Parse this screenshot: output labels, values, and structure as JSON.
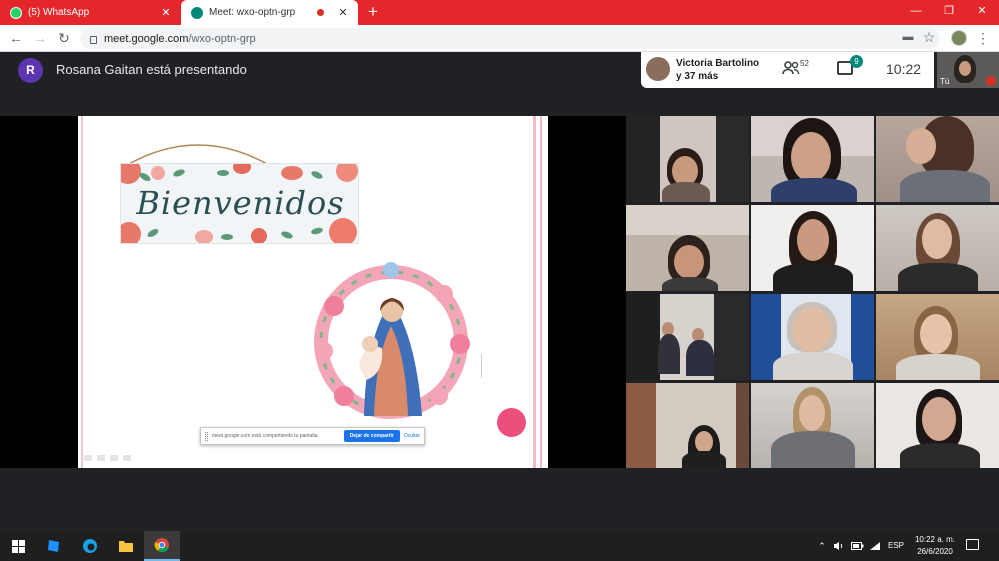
{
  "browser": {
    "tabs": [
      {
        "label": "(5) WhatsApp",
        "close": "✕"
      },
      {
        "label": "Meet: wxo-optn-grp",
        "close": "✕"
      }
    ],
    "new_tab": "+",
    "window_controls": [
      "—",
      "❐",
      "✕"
    ],
    "nav": {
      "back": "←",
      "forward": "→",
      "reload": "↻"
    },
    "url_host": "meet.google.com",
    "url_path": "/wxo-optn-grp",
    "toolbar_icons": {
      "camera": "▬",
      "star": "☆",
      "menu": "⋮"
    }
  },
  "meet": {
    "presenter_initial": "R",
    "presenter_text": "Rosana Gaitan está presentando",
    "featured_name_line1": "Victoria Bartolino",
    "featured_name_line2": "y 37 más",
    "people_count": "52",
    "chat_badge": "9",
    "clock": "10:22",
    "self_label": "Tú"
  },
  "slide": {
    "banner_text": "Bienvenidos",
    "share_text": "meet.google.com está compartiendo tu pantalla.",
    "stop_share_label": "Dejar de compartir",
    "hide_label": "Ocultar"
  },
  "taskbar": {
    "tray_chevron": "⌃",
    "language": "ESP",
    "time": "10:22 a. m.",
    "date": "26/6/2020"
  },
  "colors": {
    "chrome_tabstrip": "#e3272b",
    "meet_bg": "#202124",
    "presenter_avatar": "#5e35b1",
    "chat_badge": "#00897b",
    "stop_share_button": "#1a73e8",
    "pink_circle": "#ec4f7c"
  }
}
